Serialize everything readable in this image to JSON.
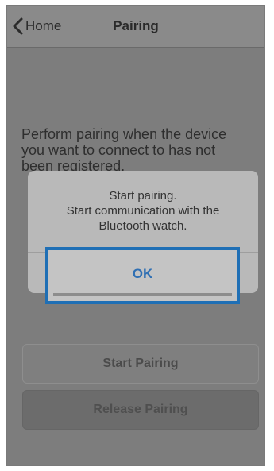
{
  "navbar": {
    "back_label": "Home",
    "back_icon": "chevron-left-icon",
    "title": "Pairing"
  },
  "main": {
    "description_lines": [
      "Perform pairing when the device",
      "you want to connect to has not",
      "been registered."
    ],
    "start_button": "Start Pairing",
    "release_button": "Release Pairing"
  },
  "dialog": {
    "line1": "Start pairing.",
    "line2": "Start communication with the",
    "line3": "Bluetooth watch.",
    "ok_label": "OK"
  },
  "colors": {
    "highlight": "#1f6fb5",
    "ok_text": "#2f6fb3",
    "overlay": "#7d7d7d"
  }
}
